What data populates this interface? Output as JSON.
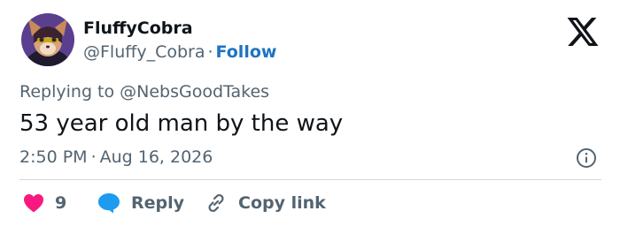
{
  "user": {
    "display_name": "FluffyCobra",
    "handle": "@Fluffy_Cobra",
    "separator": "·",
    "follow_label": "Follow"
  },
  "tweet": {
    "replying_to": "Replying to @NebsGoodTakes",
    "text": "53 year old man by the way",
    "time": "2:50 PM",
    "separator": "·",
    "date": "Aug 16, 2026"
  },
  "actions": {
    "like_count": "9",
    "reply_label": "Reply",
    "copy_label": "Copy link"
  },
  "colors": {
    "like": "#f91880",
    "reply": "#1d9bf0",
    "follow": "#1d74c2",
    "secondary_text": "#536471",
    "divider": "#cfd9de"
  },
  "icons": {
    "logo": "x-logo-icon",
    "info": "info-icon",
    "like": "heart-icon",
    "reply": "speech-bubble-icon",
    "copy": "link-icon"
  }
}
